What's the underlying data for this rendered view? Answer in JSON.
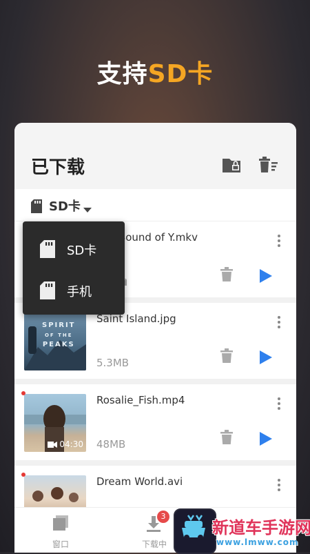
{
  "promo": {
    "prefix": "支持",
    "accent": "SD卡"
  },
  "header": {
    "title": "已下载",
    "icons": [
      "folder-lock-icon",
      "delete-list-icon"
    ]
  },
  "filter": {
    "label": "SD卡",
    "icon": "sd-card-icon"
  },
  "dropdown": {
    "options": [
      {
        "label": "SD卡",
        "icon": "sd-card-icon"
      },
      {
        "label": "手机",
        "icon": "sd-card-icon"
      }
    ]
  },
  "files": [
    {
      "name": "The Sound of Y.mkv",
      "size": "MB",
      "type": "video",
      "has_dot": false
    },
    {
      "name": "Saint Island.jpg",
      "size": "5.3MB",
      "type": "image",
      "has_dot": false,
      "thumb_text_1": "SPIRIT",
      "thumb_text_2": "OF THE",
      "thumb_text_3": "PEAKS"
    },
    {
      "name": "Rosalie_Fish.mp4",
      "size": "48MB",
      "type": "video",
      "duration": "04:30",
      "has_dot": true
    },
    {
      "name": "Dream World.avi",
      "size": "",
      "type": "video",
      "has_dot": true
    }
  ],
  "bottom_nav": {
    "items": [
      {
        "label": "窗口",
        "icon": "window-icon"
      },
      {
        "label": "下载中",
        "icon": "download-icon",
        "badge": "3"
      }
    ]
  },
  "watermark": {
    "text": "新道车手游网",
    "url": "www.lmww.com"
  },
  "colors": {
    "accent": "#f5a623",
    "play": "#2f80ed",
    "badge": "#e64a4a"
  }
}
